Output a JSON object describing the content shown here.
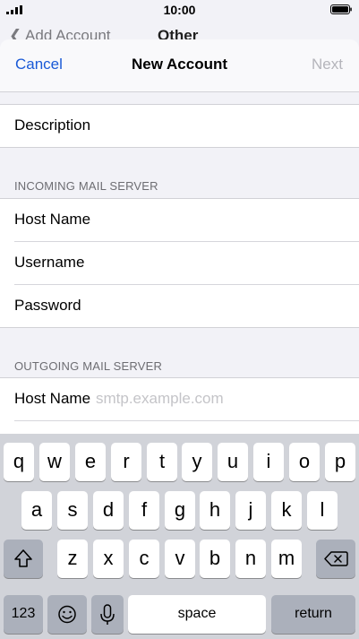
{
  "status_bar": {
    "time": "10:00"
  },
  "behind_nav": {
    "back_label": "Add Account",
    "title": "Other"
  },
  "nav": {
    "cancel": "Cancel",
    "title": "New Account",
    "next": "Next"
  },
  "form": {
    "description_label": "Description",
    "incoming_header": "INCOMING MAIL SERVER",
    "incoming": {
      "host_name_label": "Host Name",
      "username_label": "Username",
      "password_label": "Password"
    },
    "outgoing_header": "OUTGOING MAIL SERVER",
    "outgoing": {
      "host_name_label": "Host Name",
      "host_name_placeholder": "smtp.example.com"
    }
  },
  "keyboard": {
    "row1": [
      "q",
      "w",
      "e",
      "r",
      "t",
      "y",
      "u",
      "i",
      "o",
      "p"
    ],
    "row2": [
      "a",
      "s",
      "d",
      "f",
      "g",
      "h",
      "j",
      "k",
      "l"
    ],
    "row3": [
      "z",
      "x",
      "c",
      "v",
      "b",
      "n",
      "m"
    ],
    "numbers_label": "123",
    "space_label": "space",
    "return_label": "return"
  },
  "icons": {
    "shift": "shift-icon",
    "delete": "delete-icon",
    "emoji": "emoji-icon",
    "mic": "microphone-icon"
  }
}
